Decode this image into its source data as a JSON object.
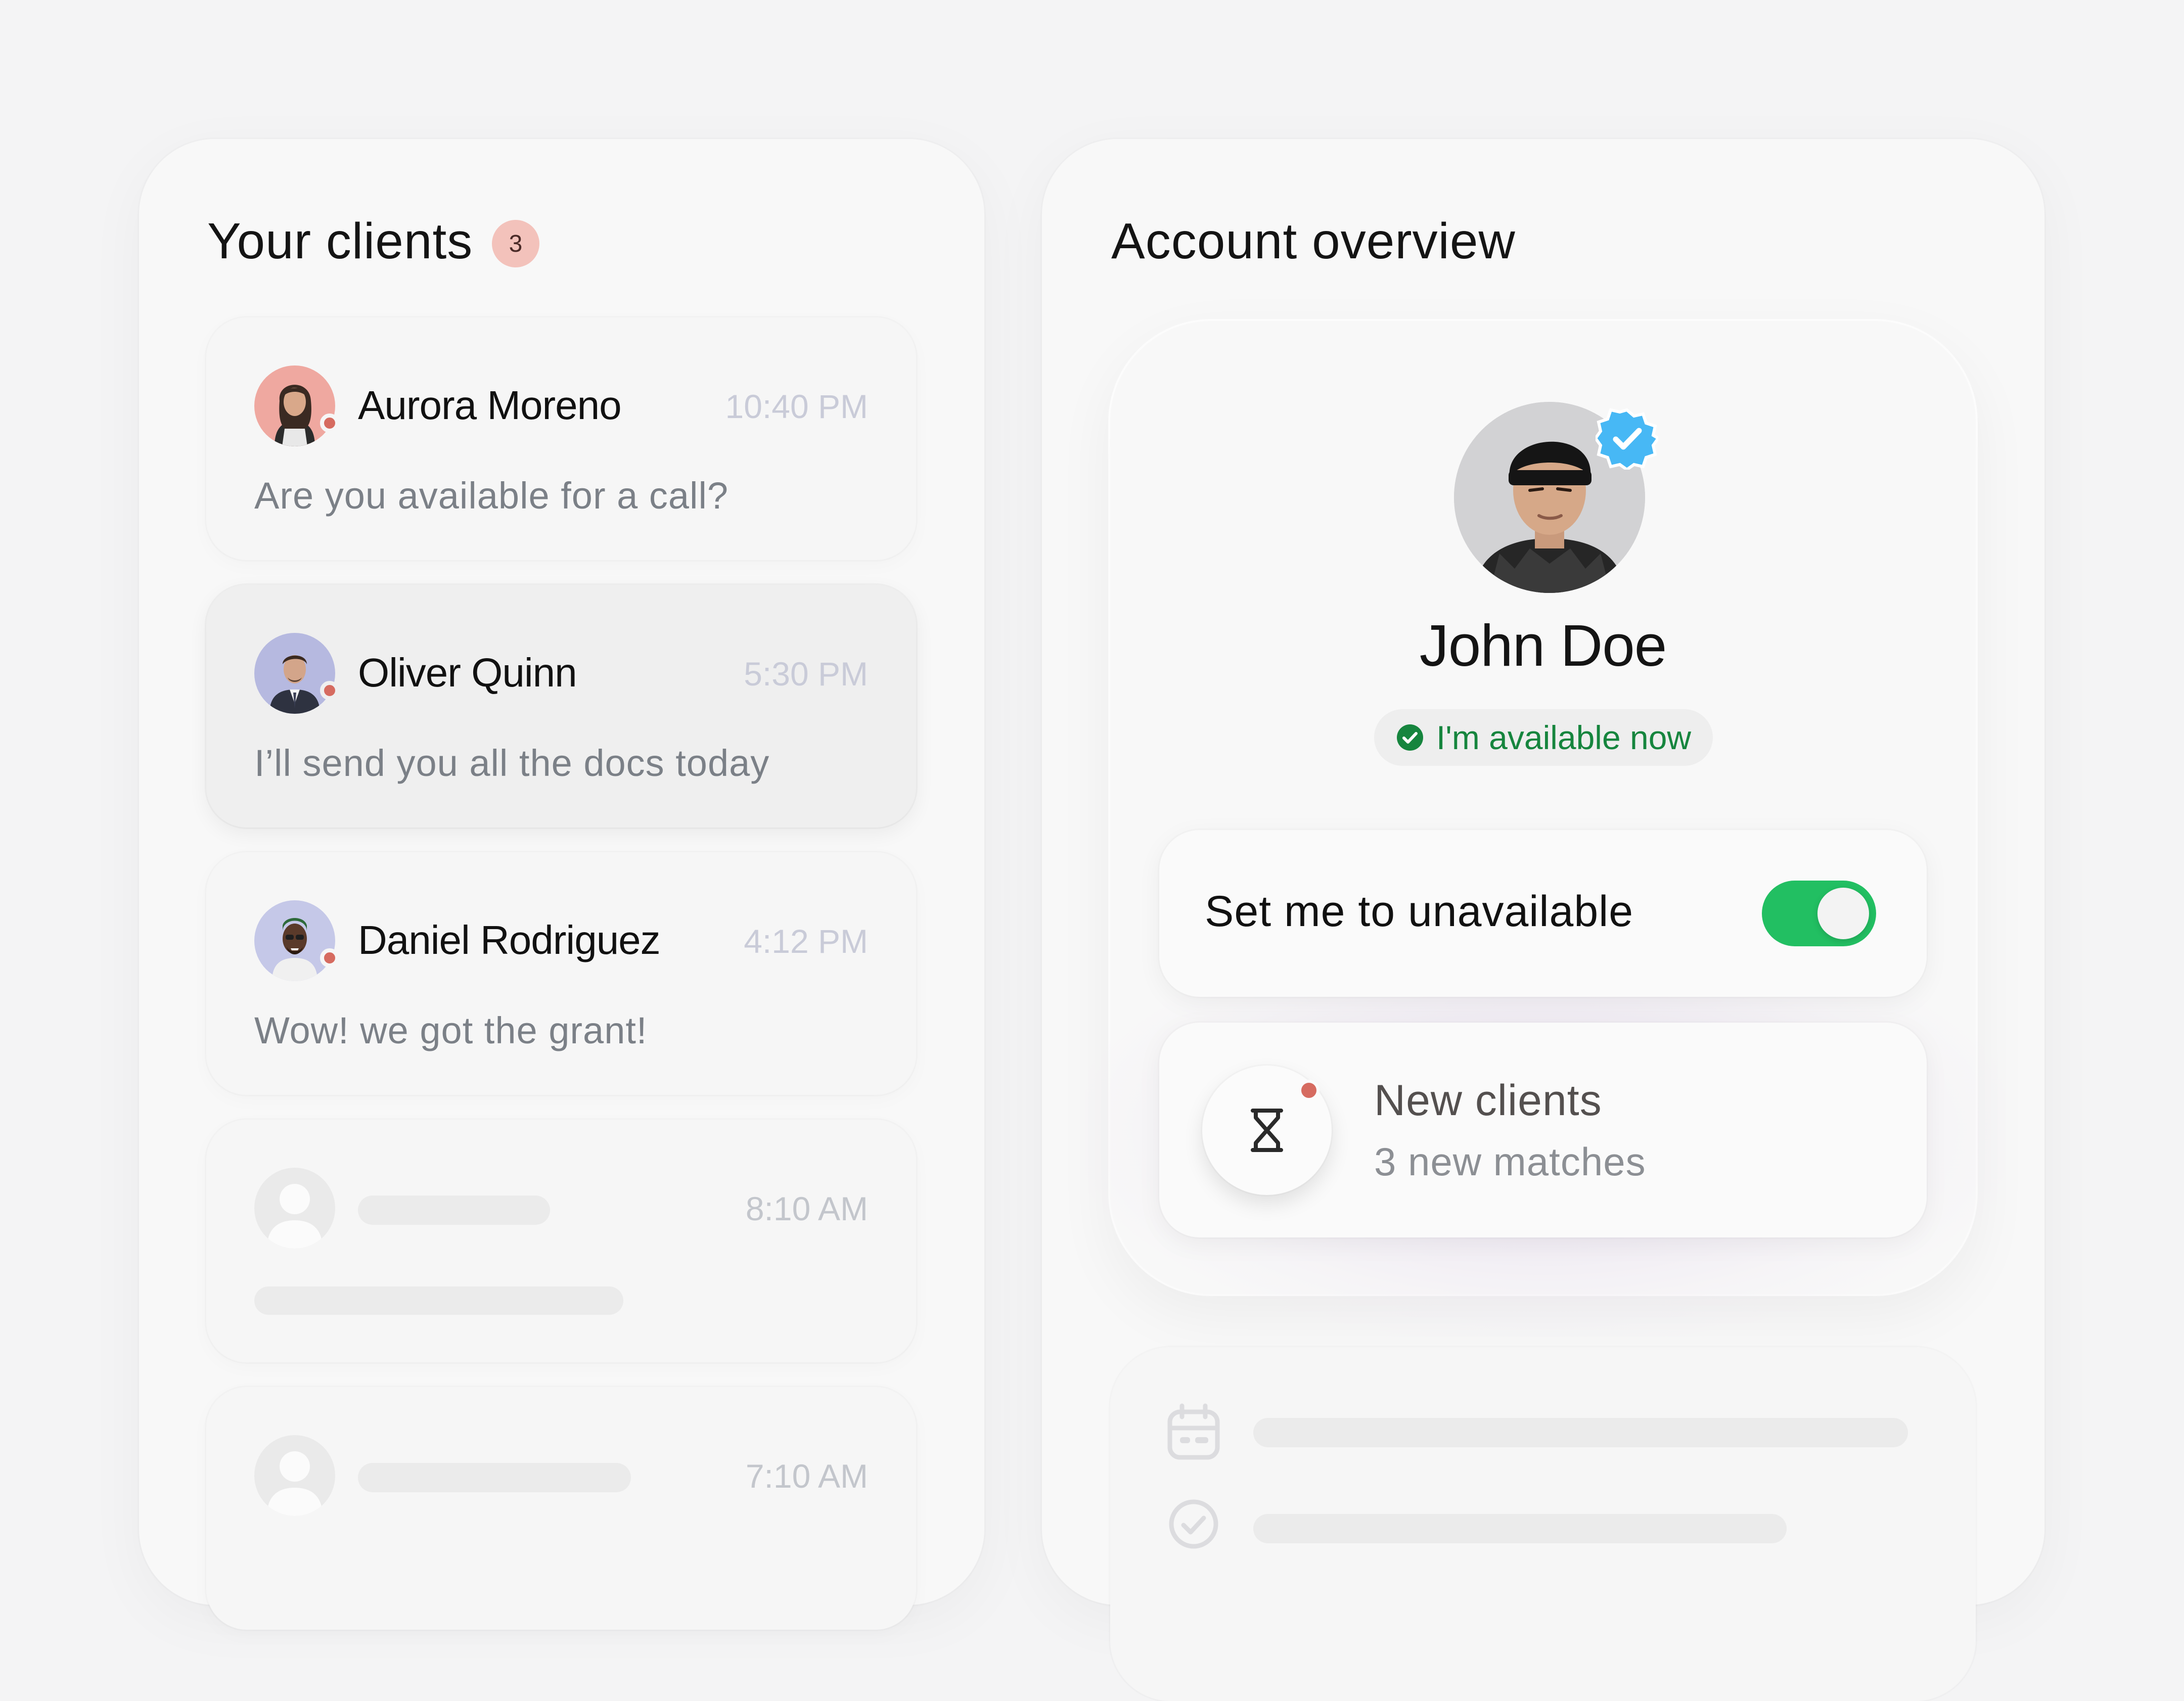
{
  "clients_panel": {
    "title": "Your clients",
    "badge_count": "3",
    "clients": [
      {
        "name": "Aurora Moreno",
        "time": "10:40 PM",
        "message": "Are you available for a call?"
      },
      {
        "name": "Oliver Quinn",
        "time": "5:30 PM",
        "message": "I’ll send you all the docs today"
      },
      {
        "name": "Daniel Rodriguez",
        "time": "4:12 PM",
        "message": "Wow! we got the grant!"
      }
    ],
    "placeholders": [
      {
        "time": "8:10 AM"
      },
      {
        "time": "7:10 AM"
      }
    ]
  },
  "account_panel": {
    "title": "Account overview",
    "profile": {
      "name": "John Doe",
      "status": "I'm available now"
    },
    "availability_toggle": {
      "label": "Set me to unavailable",
      "on": true
    },
    "new_clients": {
      "title": "New clients",
      "subtitle": "3 new matches"
    }
  },
  "colors": {
    "badge_bg": "#f3c2bb",
    "online_dot": "#d66b60",
    "toggle_on": "#22bf62",
    "status_green": "#16853e",
    "verified_blue": "#47b8f5"
  },
  "icons": [
    "verified-badge-icon",
    "check-circle-icon",
    "hourglass-icon",
    "calendar-icon",
    "user-placeholder-icon"
  ]
}
